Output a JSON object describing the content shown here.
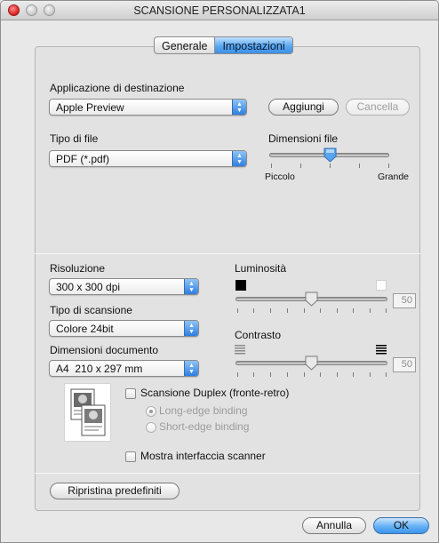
{
  "window": {
    "title": "SCANSIONE PERSONALIZZATA1"
  },
  "tabs": [
    {
      "label": "Generale",
      "active": false
    },
    {
      "label": "Impostazioni",
      "active": true
    }
  ],
  "destination": {
    "label": "Applicazione di destinazione",
    "selected": "Apple Preview",
    "add_label": "Aggiungi",
    "delete_label": "Cancella"
  },
  "file_type": {
    "label": "Tipo di file",
    "selected": "PDF (*.pdf)"
  },
  "file_size": {
    "label": "Dimensioni file",
    "min_label": "Piccolo",
    "max_label": "Grande",
    "level": 0.4
  },
  "resolution": {
    "label": "Risoluzione",
    "selected": "300 x 300 dpi"
  },
  "scan_type": {
    "label": "Tipo di scansione",
    "selected": "Colore 24bit"
  },
  "document_size": {
    "label": "Dimensioni documento",
    "selected": "A4  210 x 297 mm"
  },
  "brightness": {
    "label": "Luminosità",
    "value": "50",
    "level": 0.5
  },
  "contrast": {
    "label": "Contrasto",
    "value": "50",
    "level": 0.5
  },
  "duplex": {
    "label": "Scansione Duplex (fronte-retro)",
    "checked": false,
    "long_edge": "Long-edge binding",
    "short_edge": "Short-edge binding"
  },
  "scanner_interface": {
    "label": "Mostra interfaccia scanner",
    "checked": false
  },
  "buttons": {
    "restore": "Ripristina predefiniti",
    "cancel": "Annulla",
    "ok": "OK"
  },
  "colors": {
    "accent": "#4a9bec",
    "panel": "#e2e2e2",
    "window": "#e8e8e8"
  },
  "icons": {
    "window_controls": [
      "close-icon",
      "minimize-icon",
      "zoom-icon"
    ],
    "popup_arrow": "chevron-updown-icon",
    "brightness_min": "black-square-icon",
    "brightness_max": "white-square-icon",
    "contrast_min": "low-contrast-icon",
    "contrast_max": "high-contrast-icon",
    "duplex_preview": "duplex-document-icon"
  }
}
